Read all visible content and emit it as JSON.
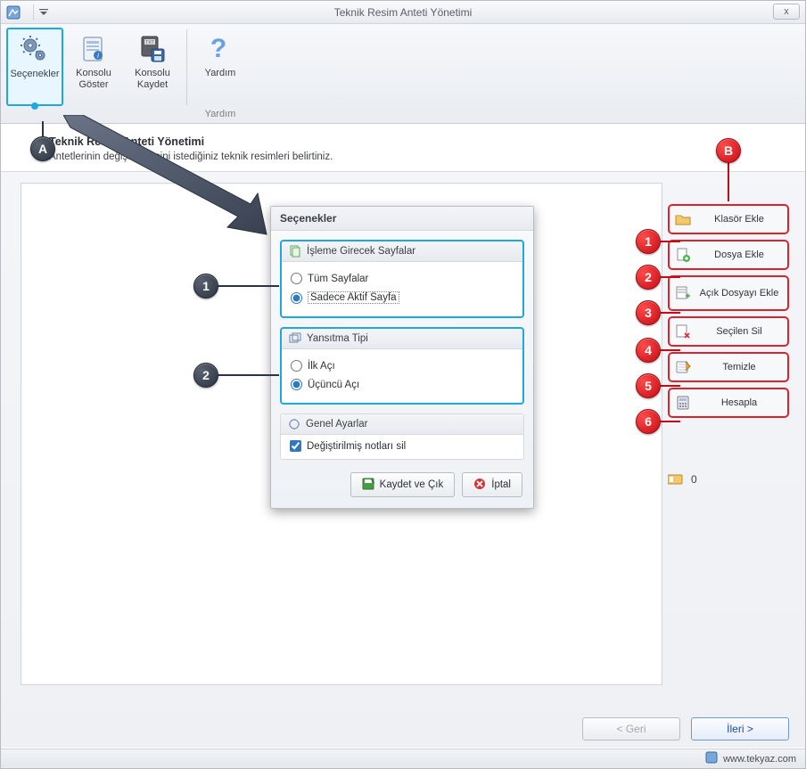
{
  "titlebar": {
    "title": "Teknik Resim Anteti Yönetimi",
    "close_glyph": "x"
  },
  "ribbon": {
    "group1_label": "",
    "group2_label": "Yardım",
    "btn_options": "Seçenekler",
    "btn_show_console": "Konsolu Göster",
    "btn_save_console": "Konsolu Kaydet",
    "btn_help": "Yardım"
  },
  "infoband": {
    "heading": "Teknik Resim Anteti Yönetimi",
    "sub": "Antetlerinin değiştirilmesini istediğiniz teknik resimleri belirtiniz."
  },
  "dialog": {
    "title": "Seçenekler",
    "g1_head": "İşleme Girecek Sayfalar",
    "g1_opt1": "Tüm Sayfalar",
    "g1_opt2": "Sadece Aktif Sayfa",
    "g2_head": "Yansıtma Tipi",
    "g2_opt1": "İlk Açı",
    "g2_opt2": "Üçüncü Açı",
    "g3_head": "Genel Ayarlar",
    "g3_chk": "Değiştirilmiş notları sil",
    "save": "Kaydet ve Çık",
    "cancel": "İptal"
  },
  "sidebuttons": {
    "b1": "Klasör Ekle",
    "b2": "Dosya Ekle",
    "b3": "Açık Dosyayı Ekle",
    "b4": "Seçilen Sil",
    "b5": "Temizle",
    "b6": "Hesapla"
  },
  "count_value": "0",
  "footer": {
    "back": "< Geri",
    "next": "İleri >"
  },
  "status": {
    "url": "www.tekyaz.com"
  },
  "markers": {
    "A": "A",
    "B": "B",
    "m1": "1",
    "m2": "2",
    "m3": "3",
    "m4": "4",
    "m5": "5",
    "m6": "6",
    "d1": "1",
    "d2": "2"
  }
}
